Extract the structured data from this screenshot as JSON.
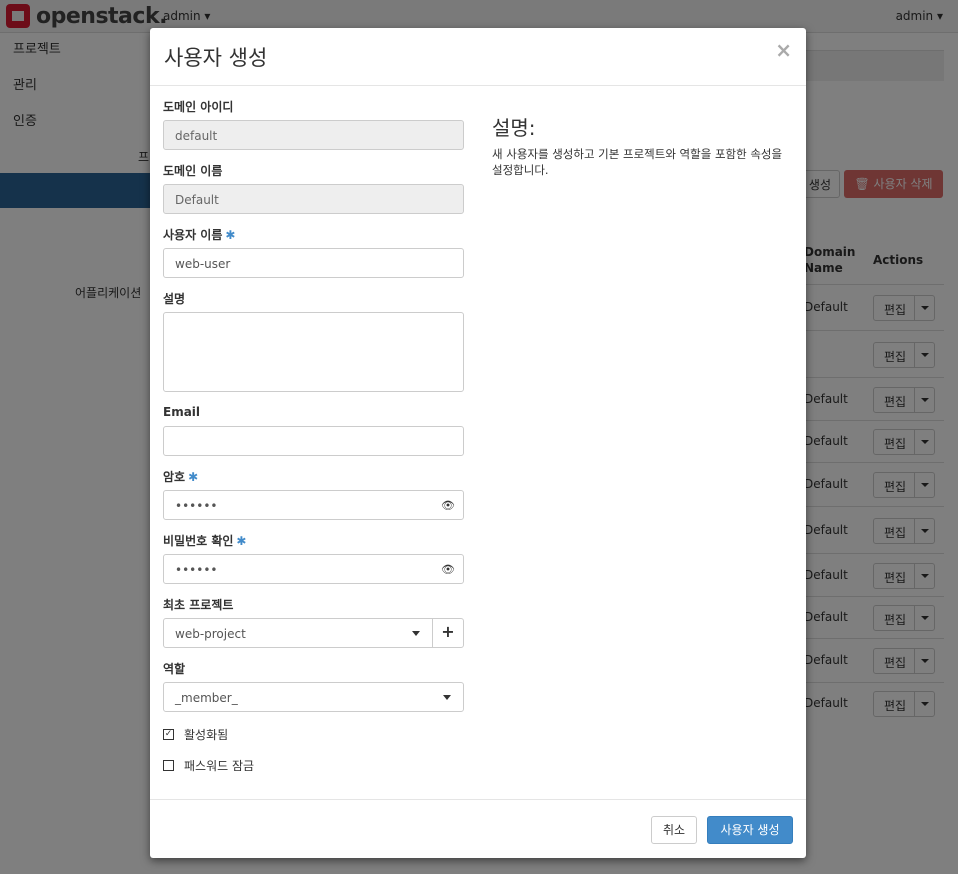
{
  "topbar": {
    "logo_text": "openstack.",
    "project": "admin ▾",
    "user": "admin ▾"
  },
  "sidebar": {
    "items": [
      "프로젝트",
      "관리",
      "인증"
    ],
    "sub_label": "프",
    "app_label": "어플리케이션"
  },
  "background": {
    "create_button": "생성",
    "delete_button": "🗑 사용자 삭제",
    "col_domain": "Domain Name",
    "col_actions": "Actions",
    "rows": [
      {
        "domain": "Default",
        "edit": "편집"
      },
      {
        "domain": "",
        "edit": "편집"
      },
      {
        "domain": "Default",
        "edit": "편집"
      },
      {
        "domain": "Default",
        "edit": "편집"
      },
      {
        "domain": "Default",
        "edit": "편집"
      },
      {
        "domain": "Default",
        "edit": "편집"
      },
      {
        "domain": "Default",
        "edit": "편집"
      },
      {
        "domain": "Default",
        "edit": "편집"
      },
      {
        "domain": "Default",
        "edit": "편집"
      },
      {
        "domain": "Default",
        "edit": "편집"
      }
    ]
  },
  "modal": {
    "title": "사용자 생성",
    "close": "×",
    "fields": {
      "domain_id_label": "도메인 아이디",
      "domain_id_value": "default",
      "domain_name_label": "도메인 이름",
      "domain_name_value": "Default",
      "username_label": "사용자 이름",
      "username_value": "web-user",
      "description_label": "설명",
      "email_label": "Email",
      "password_label": "암호",
      "password_value": "••••••",
      "confirm_label": "비밀번호 확인",
      "confirm_value": "••••••",
      "project_label": "최초 프로젝트",
      "project_value": "web-project",
      "project_add": "+",
      "role_label": "역할",
      "role_value": "_member_",
      "enabled_label": "활성화됨",
      "lock_password_label": "패스워드 잠금",
      "required_mark": "✱"
    },
    "help": {
      "title": "설명:",
      "text": "새 사용자를 생성하고 기본 프로젝트와 역할을 포함한 속성을 설정합니다."
    },
    "footer": {
      "cancel": "취소",
      "submit": "사용자 생성"
    }
  }
}
